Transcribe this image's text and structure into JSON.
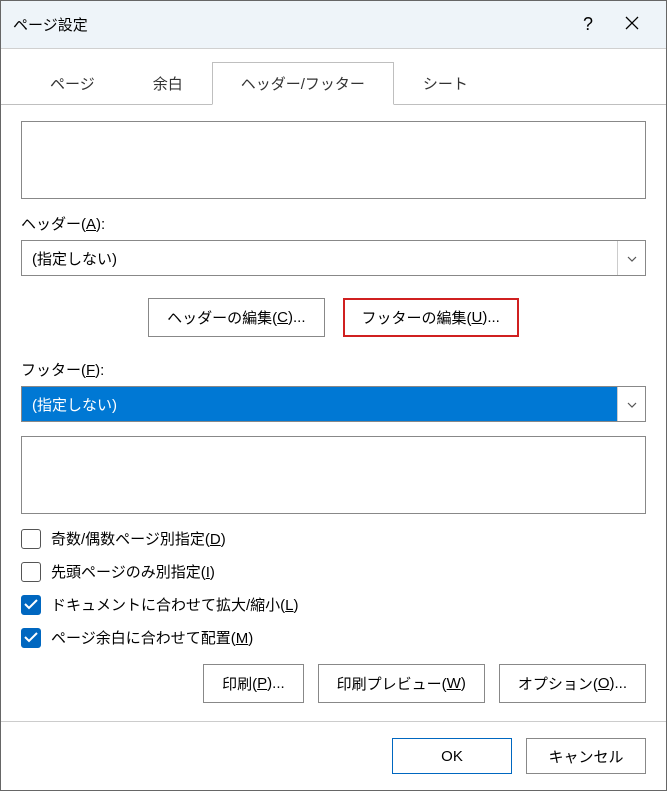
{
  "title": "ページ設定",
  "tabs": {
    "page": "ページ",
    "margins": "余白",
    "headerfooter": "ヘッダー/フッター",
    "sheet": "シート"
  },
  "header_label_pre": "ヘッダー(",
  "header_label_key": "A",
  "header_label_post": "):",
  "header_value": "(指定しない)",
  "edit_header_pre": "ヘッダーの編集(",
  "edit_header_key": "C",
  "edit_header_post": ")...",
  "edit_footer_pre": "フッターの編集(",
  "edit_footer_key": "U",
  "edit_footer_post": ")...",
  "footer_label_pre": "フッター(",
  "footer_label_key": "F",
  "footer_label_post": "):",
  "footer_value": "(指定しない)",
  "chk_odd_even_pre": "奇数/偶数ページ別指定(",
  "chk_odd_even_key": "D",
  "chk_odd_even_post": ")",
  "chk_first_pre": "先頭ページのみ別指定(",
  "chk_first_key": "I",
  "chk_first_post": ")",
  "chk_scale_pre": "ドキュメントに合わせて拡大/縮小(",
  "chk_scale_key": "L",
  "chk_scale_post": ")",
  "chk_align_pre": "ページ余白に合わせて配置(",
  "chk_align_key": "M",
  "chk_align_post": ")",
  "print_pre": "印刷(",
  "print_key": "P",
  "print_post": ")...",
  "preview_pre": "印刷プレビュー(",
  "preview_key": "W",
  "preview_post": ")",
  "options_pre": "オプション(",
  "options_key": "O",
  "options_post": ")...",
  "ok": "OK",
  "cancel": "キャンセル"
}
